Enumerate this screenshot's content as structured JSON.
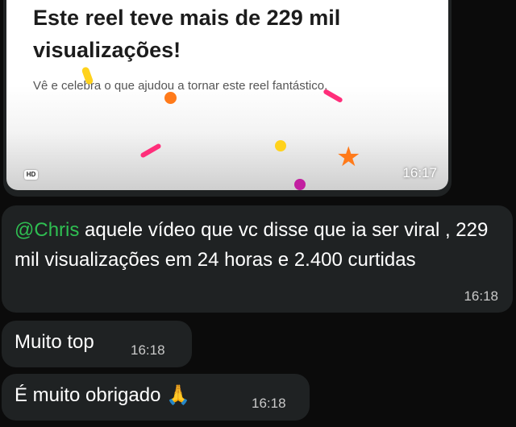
{
  "shared_reel": {
    "title": "Este reel teve mais de 229 mil visualizações!",
    "subtitle": "Vê e celebra o que ajudou a tornar este reel fantástico.",
    "hd_badge": "HD",
    "time": "16:17"
  },
  "messages": [
    {
      "mention": "@Chris",
      "text": "  aquele vídeo que vc disse que ia ser viral , 229 mil visualizações em 24 horas e 2.400 curtidas",
      "time": "16:18"
    },
    {
      "text": "Muito top",
      "time": "16:18"
    },
    {
      "text": "É muito obrigado 🙏",
      "time": "16:18"
    }
  ],
  "colors": {
    "background": "#0b0b0b",
    "bubble": "#1f2223",
    "mention": "#2fbf52"
  }
}
